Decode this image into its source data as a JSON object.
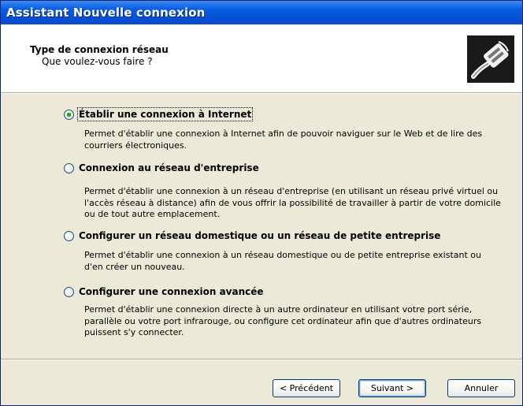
{
  "window": {
    "title": "Assistant Nouvelle connexion"
  },
  "header": {
    "title": "Type de connexion réseau",
    "subtitle": "Que voulez-vous faire ?",
    "icon": "network-cable-icon"
  },
  "options": [
    {
      "label": "Établir une connexion à Internet",
      "checked": true,
      "description": "Permet d'établir une connexion à Internet afin de pouvoir naviguer sur le Web et de lire des courriers électroniques."
    },
    {
      "label": "Connexion au réseau d'entreprise",
      "checked": false,
      "description": "Permet d'établir une connexion à un réseau d'entreprise (en utilisant un réseau privé virtuel ou l'accès réseau à distance) afin de vous offrir la possibilité de travailler à partir de votre domicile ou de tout autre emplacement."
    },
    {
      "label": "Configurer un réseau domestique ou un réseau de petite entreprise",
      "checked": false,
      "description": "Permet d'établir une connexion à un réseau domestique ou de petite entreprise existant ou d'en créer un nouveau."
    },
    {
      "label": "Configurer une connexion avancée",
      "checked": false,
      "description": "Permet d'établir une connexion directe à un autre ordinateur en utilisant votre port série, parallèle ou votre port infrarouge, ou configure cet ordinateur afin que d'autres ordinateurs puissent s'y connecter."
    }
  ],
  "buttons": {
    "back": "< Précédent",
    "next": "Suivant >",
    "cancel": "Annuler"
  }
}
